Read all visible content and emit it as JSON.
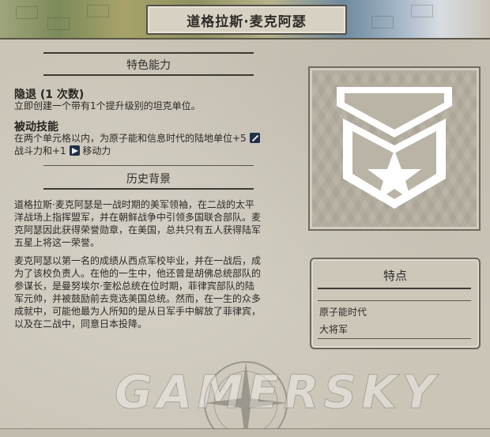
{
  "leader": {
    "name": "道格拉斯·麦克阿瑟"
  },
  "special_ability": {
    "heading": "特色能力",
    "active": {
      "name": "隐退 (1 次数)",
      "description": "立即创建一个带有1个提升级别的坦克单位。"
    },
    "passive": {
      "name": "被动技能",
      "desc_line1": "在两个单元格以内，为原子能和信息时代的陆地单位+5",
      "desc_line2a": "战斗力和+1",
      "desc_line2b": "移动力",
      "icon_combat": "sword-icon",
      "icon_movement": "movement-icon"
    }
  },
  "history": {
    "heading": "历史背景",
    "para1_lines": [
      "道格拉斯·麦克阿瑟是一战时期的美军领袖，在二战的太平",
      "洋战场上指挥盟军，并在朝鲜战争中引领多国联合部队。麦",
      "克阿瑟因此获得荣誉勋章，在美国，总共只有五人获得陆军",
      "五星上将这一荣誉。"
    ],
    "para2_lines": [
      "麦克阿瑟以第一名的成绩从西点军校毕业，并在一战后，成",
      "为了该校负责人。在他的一生中，他还曾是胡佛总统部队的",
      "参谋长，是曼努埃尔·奎松总统在位时期，菲律宾部队的陆",
      "军元帅，并被鼓励前去竞选美国总统。然而，在一生的众多",
      "成就中，可能他最为人所知的是从日军手中解放了菲律宾，",
      "以及在二战中，同意日本投降。"
    ]
  },
  "emblem": {
    "icon": "general-star-shield-icon",
    "color": "#ffffff"
  },
  "traits": {
    "heading": "特点",
    "items": [
      "原子能时代",
      "大将军"
    ]
  },
  "watermark": "GAMERSKY"
}
